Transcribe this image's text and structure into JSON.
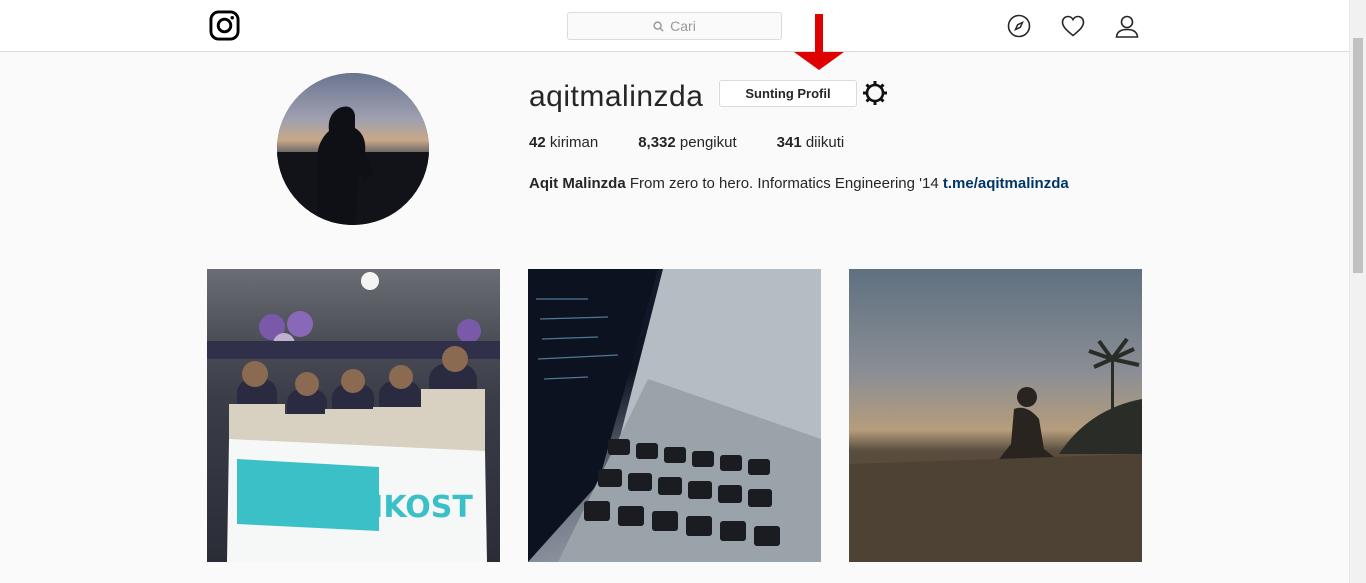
{
  "search": {
    "placeholder": "Cari"
  },
  "profile": {
    "username": "aqitmalinzda",
    "edit_button": "Sunting Profil",
    "stats": [
      {
        "count": "42",
        "label": "kiriman"
      },
      {
        "count": "8,332",
        "label": "pengikut"
      },
      {
        "count": "341",
        "label": "diikuti"
      }
    ],
    "full_name": "Aqit Malinzda",
    "bio": "From zero to hero. Informatics Engineering '14",
    "link": "t.me/aqitmalinzda"
  },
  "posts": [
    {
      "banner_text": "INDIKOST"
    },
    {
      "banner_text": ""
    },
    {
      "banner_text": ""
    }
  ],
  "icons": {
    "logo": "instagram-logo-icon",
    "search": "search-icon",
    "explore": "compass-icon",
    "activity": "heart-icon",
    "profile": "user-icon",
    "settings": "gear-icon",
    "annotation": "red-arrow-icon"
  },
  "colors": {
    "annotation_arrow": "#e00000",
    "link": "#003569",
    "border": "#dbdbdb"
  }
}
